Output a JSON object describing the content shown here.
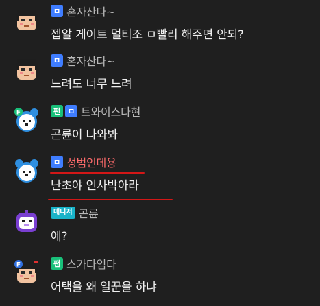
{
  "colors": {
    "background": "#1f1f1f",
    "subscriber_badge": "#3f7dff",
    "fan_badge": "#19c07a",
    "manager_badge": "#19b3c9",
    "highlight_underline": "#d31717"
  },
  "messages": [
    {
      "avatar_icon": "pixel-man-avatar-icon",
      "badges": [
        "subscriber-badge-icon"
      ],
      "nickname": "혼자산다~",
      "nick_color": "#b8b8b8",
      "text": "젭알 게이트 멀티조 ㅁ빨리 해주면 안되?"
    },
    {
      "avatar_icon": "pixel-man-avatar-icon",
      "badges": [
        "subscriber-badge-icon"
      ],
      "nickname": "혼자산다~",
      "nick_color": "#b8b8b8",
      "text": "느려도 너무 느려"
    },
    {
      "avatar_icon": "pixel-bear-fan-avatar-icon",
      "badges": [
        "fan-badge-icon",
        "subscriber-badge-icon"
      ],
      "fan_badge_label": "팬",
      "nickname": "트와이스다현",
      "nick_color": "#b8b8b8",
      "text": "곤륜이 나와봐"
    },
    {
      "avatar_icon": "pixel-bear-avatar-icon",
      "badges": [
        "subscriber-badge-icon"
      ],
      "nickname": "성범인데용",
      "nick_color": "#ff6b6b",
      "text": "난초야 인사박아라"
    },
    {
      "avatar_icon": "pixel-robot-avatar-icon",
      "badges": [
        "manager-badge-icon"
      ],
      "manager_badge_label": "매니저",
      "nickname": "곤륜",
      "nick_color": "#b8b8b8",
      "text": "에?"
    },
    {
      "avatar_icon": "pixel-man-fan-avatar-icon",
      "badges": [
        "fan-badge-icon"
      ],
      "fan_badge_label": "팬",
      "nickname": "스가다임다",
      "nick_color": "#b8b8b8",
      "text": "어택을 왜 일꾼을 하냐"
    }
  ]
}
